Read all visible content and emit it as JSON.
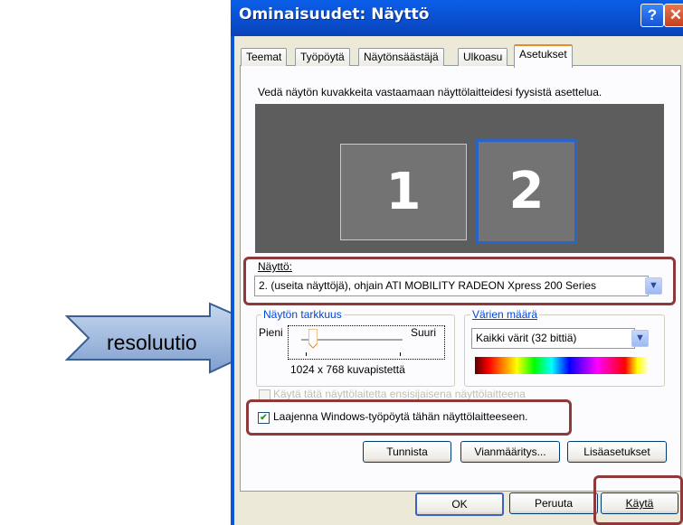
{
  "window": {
    "title": "Ominaisuudet: Näyttö",
    "help_label": "?",
    "close_label": "✕"
  },
  "tabs": [
    {
      "label": "Teemat",
      "active": false
    },
    {
      "label": "Työpöytä",
      "active": false
    },
    {
      "label": "Näytönsäästäjä",
      "active": false
    },
    {
      "label": "Ulkoasu",
      "active": false
    },
    {
      "label": "Asetukset",
      "active": true
    }
  ],
  "settings": {
    "instruction": "Vedä näytön kuvakkeita vastaamaan näyttölaitteidesi fyysistä asettelua.",
    "monitors": [
      {
        "label": "1",
        "selected": false
      },
      {
        "label": "2",
        "selected": true
      }
    ],
    "display_label": "Näyttö:",
    "display_value": "2. (useita näyttöjä), ohjain ATI MOBILITY RADEON Xpress 200 Series",
    "resolution": {
      "group_label": "Näytön tarkkuus",
      "low_label": "Pieni",
      "high_label": "Suuri",
      "value_text": "1024 x 768 kuvapistettä",
      "slider_fraction": 0.12
    },
    "color_quality": {
      "group_label": "Värien määrä",
      "value": "Kaikki värit (32 bittiä)"
    },
    "primary_checkbox": {
      "label": "Käytä tätä näyttölaitetta ensisijaisena näyttölaitteena",
      "checked": false,
      "disabled": true
    },
    "extend_checkbox": {
      "label": "Laajenna Windows-työpöytä tähän näyttölaitteeseen.",
      "checked": true
    },
    "buttons": {
      "identify": "Tunnista",
      "troubleshoot": "Vianmääritys...",
      "advanced": "Lisäasetukset"
    }
  },
  "footer": {
    "ok": "OK",
    "cancel": "Peruuta",
    "apply": "Käytä"
  },
  "callout": {
    "text": "resoluutio"
  },
  "colors": {
    "title_blue": "#0a56d8",
    "highlight_box": "#8e3a3a",
    "callout_fill": "#9db8dc"
  }
}
